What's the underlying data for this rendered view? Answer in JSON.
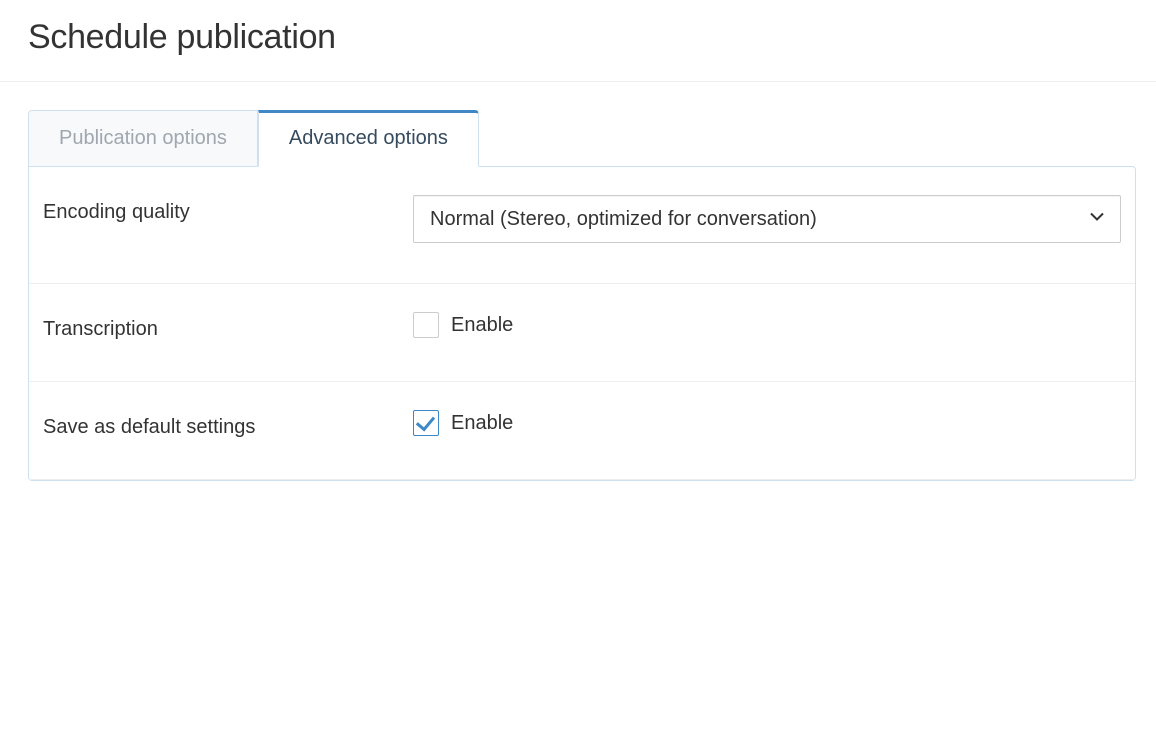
{
  "page": {
    "title": "Schedule publication"
  },
  "tabs": {
    "publication_options": {
      "label": "Publication options",
      "active": false
    },
    "advanced_options": {
      "label": "Advanced options",
      "active": true
    }
  },
  "form": {
    "encoding_quality": {
      "label": "Encoding quality",
      "selected": "Normal (Stereo, optimized for conversation)"
    },
    "transcription": {
      "label": "Transcription",
      "checkbox_label": "Enable",
      "checked": false
    },
    "save_default": {
      "label": "Save as default settings",
      "checkbox_label": "Enable",
      "checked": true
    }
  }
}
